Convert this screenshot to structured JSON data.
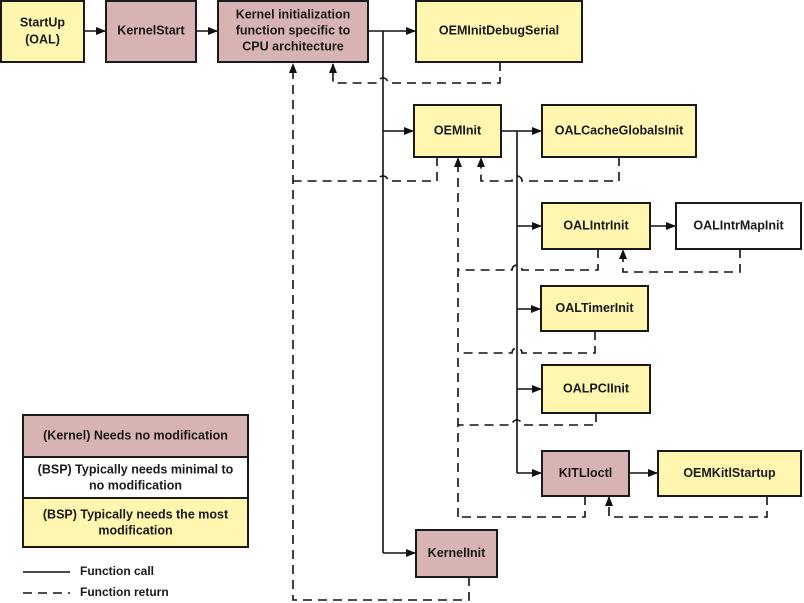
{
  "colors": {
    "kernel": "#d8b3b3",
    "bsp_minimal": "#ffffff",
    "bsp_most": "#fff6b0"
  },
  "nodes": {
    "startup": [
      "StartUp",
      "(OAL)"
    ],
    "kernelstart": "KernelStart",
    "kernel_init_cpu": [
      "Kernel initialization",
      "function specific to",
      "CPU architecture"
    ],
    "oeminitdebugserial": "OEMInitDebugSerial",
    "oeminit": "OEMInit",
    "oalcacheglobalsinit": "OALCacheGlobalsInit",
    "oalintrinit": "OALIntrInit",
    "oalintrmapinit": "OALIntrMapInit",
    "oaltimerinit": "OALTimerInit",
    "oalpciinit": "OALPCIInit",
    "kitlioctl": "KITLIoctl",
    "oemkitlstartup": "OEMKitlStartup",
    "kernelinit": "KernelInit"
  },
  "legend": {
    "kernel": "(Kernel) Needs no modification",
    "bsp_minimal": [
      "(BSP) Typically needs minimal to",
      "no modification"
    ],
    "bsp_most": [
      "(BSP) Typically needs the most",
      "modification"
    ],
    "function_call": "Function call",
    "function_return": "Function return"
  }
}
